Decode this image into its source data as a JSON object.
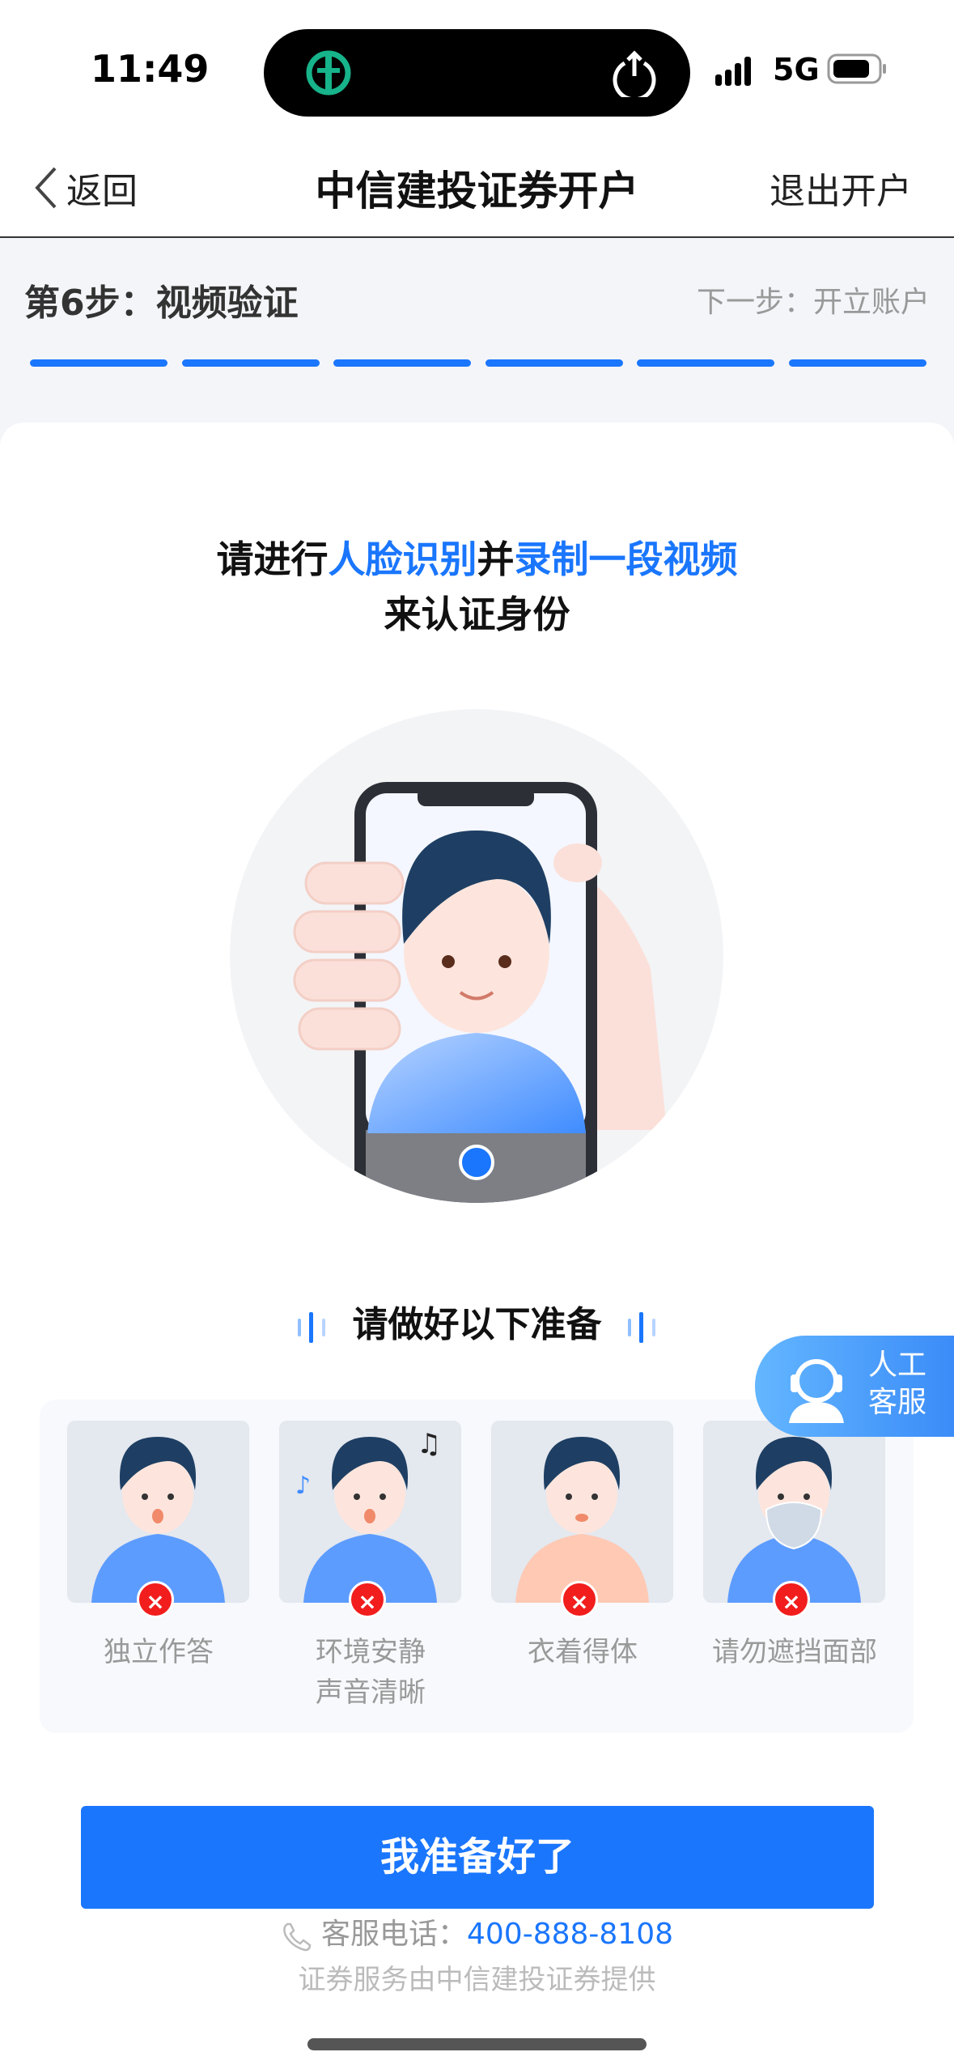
{
  "status_bar": {
    "time": "11:49",
    "network": "5G",
    "icons": [
      "bank-app-icon",
      "upload-icon",
      "signal-icon",
      "battery-icon"
    ]
  },
  "nav": {
    "back_label": "返回",
    "title": "中信建投证券开户",
    "exit_label": "退出开户"
  },
  "progress": {
    "step_label": "第6步：视频验证",
    "next_label": "下一步：开立账户",
    "current_step": 6,
    "total_steps": 6
  },
  "intro": {
    "line1_a": "请进行",
    "line1_b": "人脸识别",
    "line1_c": "并",
    "line1_d": "录制一段视频",
    "line2": "来认证身份"
  },
  "prep": {
    "title": "请做好以下准备",
    "items": [
      {
        "label": "独立作答"
      },
      {
        "label": "环境安静\n声音清晰"
      },
      {
        "label": "衣着得体"
      },
      {
        "label": "请勿遮挡面部"
      }
    ]
  },
  "customer_service": {
    "line1": "人工",
    "line2": "客服"
  },
  "ready_button": "我准备好了",
  "hotline": {
    "label": "客服电话：",
    "number": "400-888-8108"
  },
  "footer": "证券服务由中信建投证券提供",
  "colors": {
    "accent": "#1a76fd",
    "error": "#f21d1d"
  }
}
